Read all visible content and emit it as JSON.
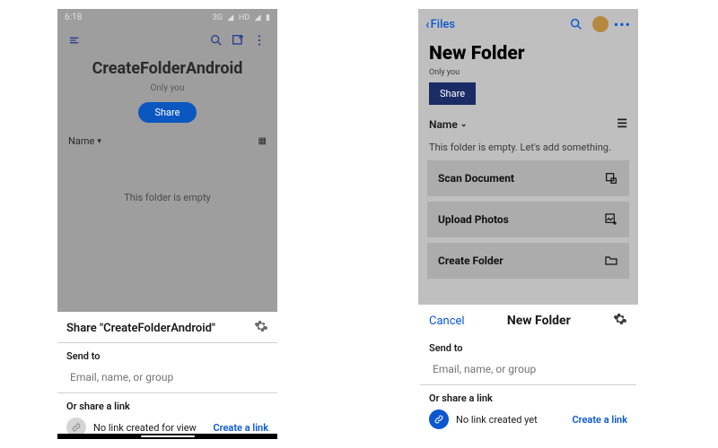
{
  "left": {
    "status": {
      "time": "6:18",
      "network": "3G",
      "hd": "HD"
    },
    "folder_title": "CreateFolderAndroid",
    "only_you": "Only you",
    "share_btn": "Share",
    "column_header": "Name",
    "empty_msg": "This folder is empty",
    "sheet": {
      "title": "Share \"CreateFolderAndroid\"",
      "send_to": "Send to",
      "input_placeholder": "Email, name, or group",
      "or_share": "Or share a link",
      "link_status": "No link created for view",
      "create_link": "Create a link"
    }
  },
  "right": {
    "back_label": "Files",
    "folder_title": "New Folder",
    "only_you": "Only you",
    "share_btn": "Share",
    "column_header": "Name",
    "empty_msg": "This folder is empty. Let's add something.",
    "cards": {
      "scan": "Scan Document",
      "upload": "Upload Photos",
      "create": "Create Folder"
    },
    "sheet": {
      "cancel": "Cancel",
      "title": "New Folder",
      "send_to": "Send to",
      "input_placeholder": "Email, name, or group",
      "or_share": "Or share a link",
      "link_status": "No link created yet",
      "create_link": "Create a link"
    }
  }
}
